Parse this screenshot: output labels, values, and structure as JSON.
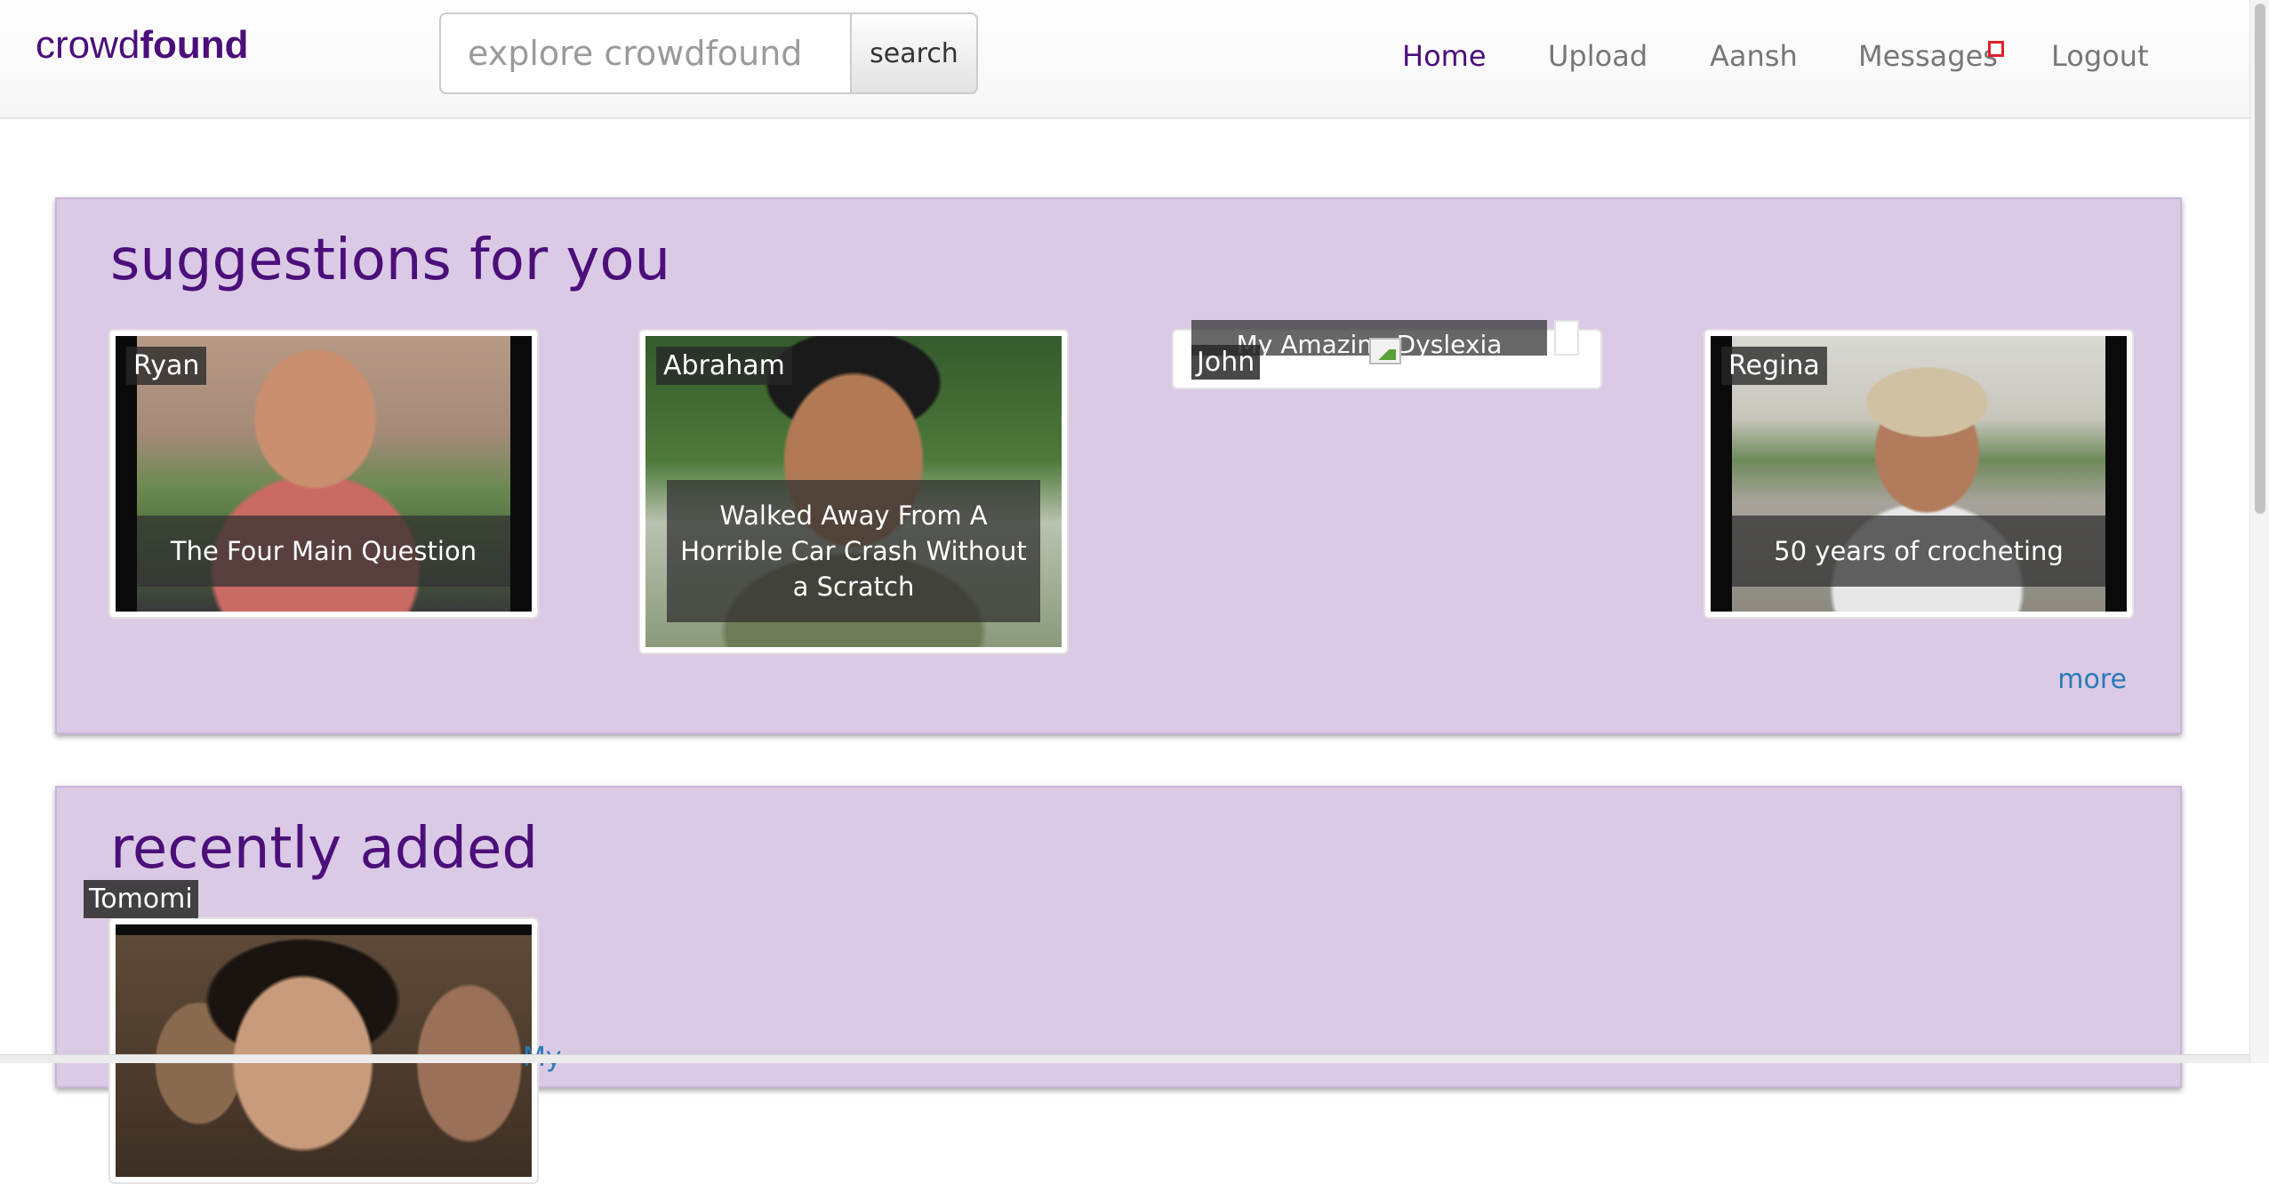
{
  "brand": {
    "prefix": "crowd",
    "suffix": "found"
  },
  "search": {
    "placeholder": "explore crowdfound",
    "button_label": "search"
  },
  "nav": {
    "home": "Home",
    "upload": "Upload",
    "user": "Aansh",
    "messages": "Messages",
    "logout": "Logout"
  },
  "suggestions": {
    "title": "suggestions for you",
    "more_label": "more",
    "cards": [
      {
        "name": "Ryan",
        "caption": "The Four Main Question"
      },
      {
        "name": "Abraham",
        "caption": "Walked Away From A Horrible Car Crash Without a Scratch"
      },
      {
        "name": "John",
        "caption": "My Amazing Dyslexia"
      },
      {
        "name": "Regina",
        "caption": "50 years of crocheting"
      }
    ]
  },
  "recent": {
    "title": "recently added",
    "cards": [
      {
        "name": "Tomomi"
      }
    ],
    "partial_link": "My"
  },
  "colors": {
    "brand_purple": "#4b0f7a",
    "panel_bg": "#dbcae5",
    "link_blue": "#2a7ab8",
    "badge_red": "#e0212b"
  }
}
